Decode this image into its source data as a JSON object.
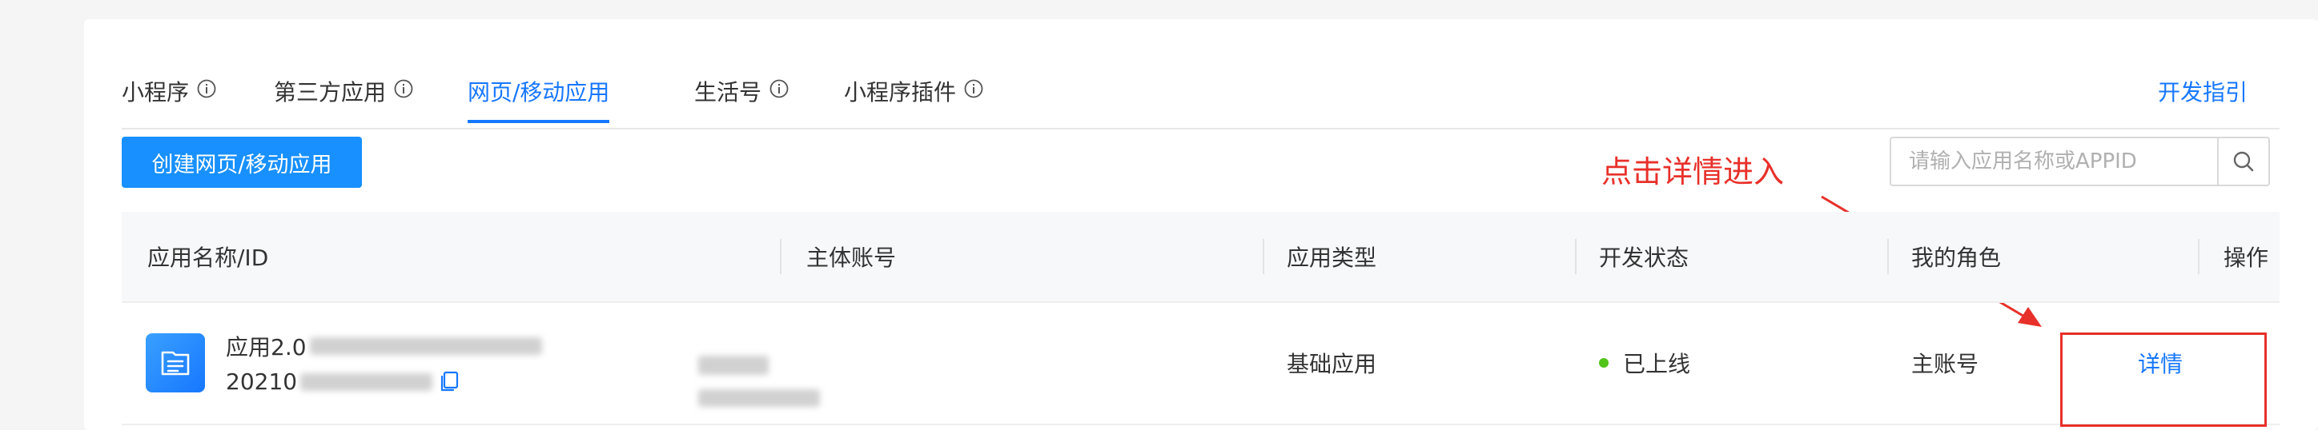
{
  "tabs": [
    {
      "label": "小程序",
      "info": true,
      "active": false
    },
    {
      "label": "第三方应用",
      "info": true,
      "active": false
    },
    {
      "label": "网页/移动应用",
      "info": false,
      "active": true
    },
    {
      "label": "生活号",
      "info": true,
      "active": false
    },
    {
      "label": "小程序插件",
      "info": true,
      "active": false
    }
  ],
  "header": {
    "guide_link": "开发指引"
  },
  "toolbar": {
    "create_label": "创建网页/移动应用",
    "search_placeholder": "请输入应用名称或APPID"
  },
  "annotation": {
    "text": "点击详情进入",
    "color": "#e8302a"
  },
  "table": {
    "columns": [
      "应用名称/ID",
      "主体账号",
      "应用类型",
      "开发状态",
      "我的角色",
      "操作"
    ],
    "rows": [
      {
        "name_prefix": "应用2.0",
        "id_prefix": "20210",
        "app_type": "基础应用",
        "status": "已上线",
        "role": "主账号",
        "action": "详情"
      }
    ]
  },
  "colors": {
    "accent": "#1677ff",
    "primary_button": "#1890ff",
    "status_online": "#52c41a"
  }
}
